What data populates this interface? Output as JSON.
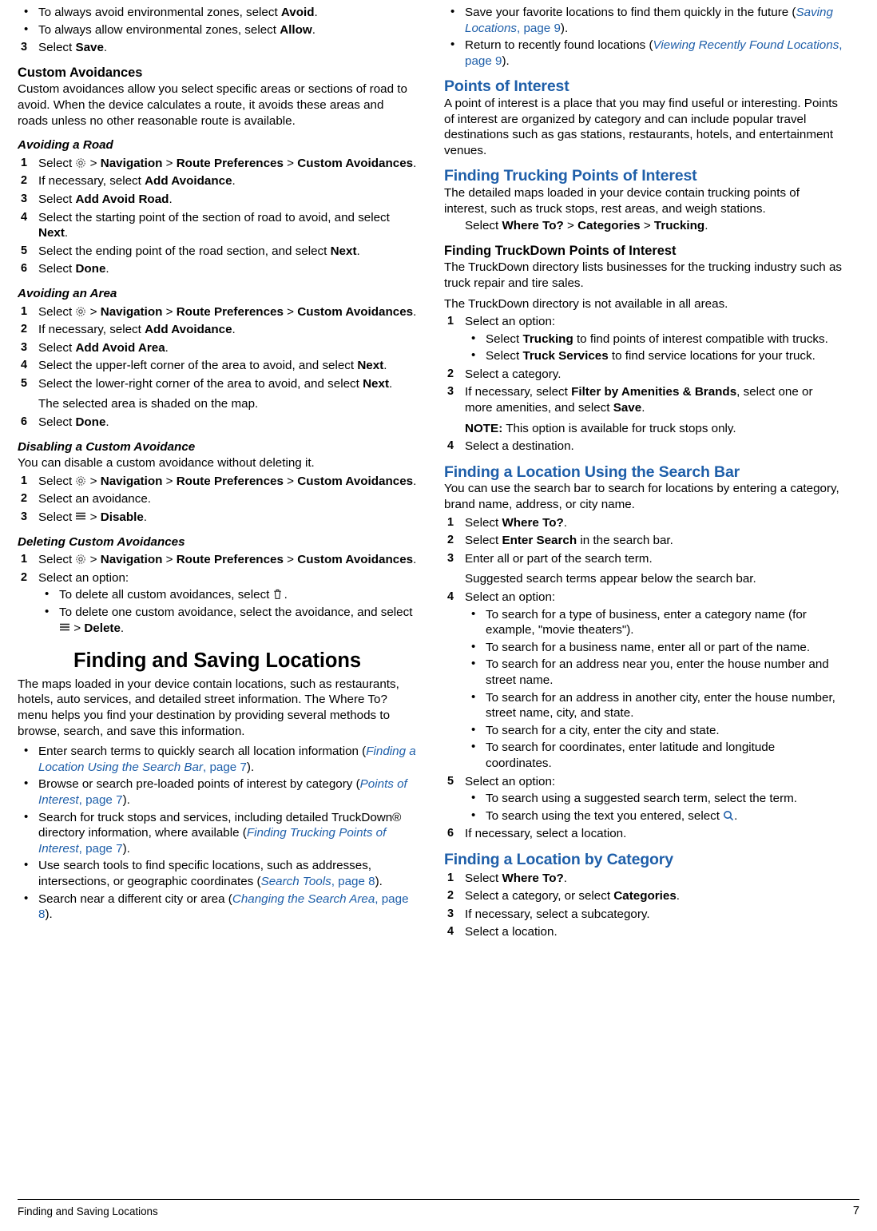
{
  "footer": {
    "left": "Finding and Saving Locations",
    "page": "7"
  },
  "left_column": {
    "top_bullets": [
      {
        "pre": "To always avoid environmental zones, select ",
        "b": "Avoid",
        "post": "."
      },
      {
        "pre": "To always allow environmental zones, select ",
        "b": "Allow",
        "post": "."
      }
    ],
    "step3": {
      "num": "3",
      "pre": "Select ",
      "b": "Save",
      "post": "."
    },
    "custom_avoidances": {
      "heading": "Custom Avoidances",
      "body": "Custom avoidances allow you select specific areas or sections of road to avoid. When the device calculates a route, it avoids these areas and roads unless no other reasonable route is available."
    },
    "avoiding_road": {
      "heading": "Avoiding a Road",
      "steps": [
        {
          "num": "1",
          "text_parts": [
            "Select ",
            "GEAR",
            " > ",
            "Navigation",
            " > ",
            "Route Preferences",
            " > ",
            "Custom Avoidances",
            "."
          ]
        },
        {
          "num": "2",
          "text_parts": [
            "If necessary, select ",
            "Add Avoidance",
            "."
          ]
        },
        {
          "num": "3",
          "text_parts": [
            "Select ",
            "Add Avoid Road",
            "."
          ]
        },
        {
          "num": "4",
          "text_parts": [
            "Select the starting point of the section of road to avoid, and select ",
            "Next",
            "."
          ]
        },
        {
          "num": "5",
          "text_parts": [
            "Select the ending point of the road section, and select ",
            "Next",
            "."
          ]
        },
        {
          "num": "6",
          "text_parts": [
            "Select ",
            "Done",
            "."
          ]
        }
      ]
    },
    "avoiding_area": {
      "heading": "Avoiding an Area",
      "steps": [
        {
          "num": "1",
          "text_parts": [
            "Select ",
            "GEAR",
            " > ",
            "Navigation",
            " > ",
            "Route Preferences",
            " > ",
            "Custom Avoidances",
            "."
          ]
        },
        {
          "num": "2",
          "text_parts": [
            "If necessary, select ",
            "Add Avoidance",
            "."
          ]
        },
        {
          "num": "3",
          "text_parts": [
            "Select ",
            "Add Avoid Area",
            "."
          ]
        },
        {
          "num": "4",
          "text_parts": [
            "Select the upper-left corner of the area to avoid, and select ",
            "Next",
            "."
          ]
        },
        {
          "num": "5",
          "text_parts": [
            "Select the lower-right corner of the area to avoid, and select ",
            "Next",
            "."
          ]
        },
        {
          "num": "6",
          "text_parts": [
            "Select ",
            "Done",
            "."
          ]
        }
      ],
      "note_after_5": "The selected area is shaded on the map."
    },
    "disabling": {
      "heading": "Disabling a Custom Avoidance",
      "body": "You can disable a custom avoidance without deleting it.",
      "steps": [
        {
          "num": "1",
          "text_parts": [
            "Select ",
            "GEAR",
            " > ",
            "Navigation",
            " > ",
            "Route Preferences",
            " > ",
            "Custom Avoidances",
            "."
          ]
        },
        {
          "num": "2",
          "text_parts": [
            "Select an avoidance."
          ]
        },
        {
          "num": "3",
          "text_parts": [
            "Select ",
            "MENU",
            " > ",
            "Disable",
            "."
          ]
        }
      ]
    },
    "deleting": {
      "heading": "Deleting Custom Avoidances",
      "steps": [
        {
          "num": "1",
          "text_parts": [
            "Select ",
            "GEAR",
            " > ",
            "Navigation",
            " > ",
            "Route Preferences",
            " > ",
            "Custom Avoidances",
            "."
          ]
        },
        {
          "num": "2",
          "text_parts": [
            "Select an option:"
          ]
        }
      ],
      "options": [
        {
          "pre": "To delete all custom avoidances, select ",
          "icon": "TRASH",
          "post": "."
        },
        {
          "pre": "To delete one custom avoidance, select the avoidance, and select ",
          "icon": "MENU",
          "mid": " > ",
          "b": "Delete",
          "post": "."
        }
      ]
    },
    "chapter_title": "Finding and Saving Locations",
    "chapter_intro": "The maps loaded in your device contain locations, such as restaurants, hotels, auto services, and detailed street information. The Where To? menu helps you find your destination by providing several methods to browse, search, and save this information.",
    "chapter_bullets": [
      {
        "text": "Enter search terms to quickly search all location information (",
        "xref": "Finding a Location Using the Search Bar",
        "xref_tail": ", page 7",
        "close": ")."
      },
      {
        "text": "Browse or search pre-loaded points of interest by category (",
        "xref": "Points of Interest",
        "xref_tail": ", page 7",
        "close": ")."
      },
      {
        "text": "Search for truck stops and services, including detailed TruckDown® directory information, where available (",
        "xref": "Finding Trucking Points of Interest",
        "xref_tail": ", page 7",
        "close": ")."
      },
      {
        "text": "Use search tools to find specific locations, such as addresses, intersections, or geographic coordinates (",
        "xref": "Search Tools",
        "xref_tail": ", page 8",
        "close": ")."
      },
      {
        "text": "Search near a different city or area (",
        "xref": "Changing the Search Area",
        "xref_tail": ", page 8",
        "close": ")."
      }
    ]
  },
  "right_column": {
    "top_bullets": [
      {
        "text": "Save your favorite locations to find them quickly in the future (",
        "xref": "Saving Locations",
        "xref_tail": ", page 9",
        "close": ")."
      },
      {
        "text": "Return to recently found locations (",
        "xref": "Viewing Recently Found Locations",
        "xref_tail": ", page 9",
        "close": ")."
      }
    ],
    "points_of_interest": {
      "heading": "Points of Interest",
      "body": "A point of interest is a place that you may find useful or interesting. Points of interest are organized by category and can include popular travel destinations such as gas stations, restaurants, hotels, and entertainment venues."
    },
    "finding_trucking_poi": {
      "heading": "Finding Trucking Points of Interest",
      "body": "The detailed maps loaded in your device contain trucking points of interest, such as truck stops, rest areas, and weigh stations.",
      "action_parts": [
        "Select ",
        "Where To?",
        " > ",
        "Categories",
        " > ",
        "Trucking",
        "."
      ]
    },
    "finding_truckdown": {
      "heading": "Finding TruckDown Points of Interest",
      "body1": "The TruckDown directory lists businesses for the trucking industry such as truck repair and tire sales.",
      "body2": "The TruckDown directory is not available in all areas.",
      "steps": [
        {
          "num": "1",
          "text": "Select an option:"
        },
        {
          "num": "2",
          "text": "Select a category."
        },
        {
          "num": "3",
          "parts": [
            "If necessary, select ",
            "Filter by Amenities & Brands",
            ", select one or more amenities, and select ",
            "Save",
            "."
          ]
        },
        {
          "num": "4",
          "text": "Select a destination."
        }
      ],
      "step1_options": [
        {
          "pre": "Select ",
          "b": "Trucking",
          "post": " to find points of interest compatible with trucks."
        },
        {
          "pre": "Select ",
          "b": "Truck Services",
          "post": " to find service locations for your truck."
        }
      ],
      "note": {
        "label": "NOTE:",
        "text": " This option is available for truck stops only."
      }
    },
    "search_bar": {
      "heading": "Finding a Location Using the Search Bar",
      "body": "You can use the search bar to search for locations by entering a category, brand name, address, or city name.",
      "steps": [
        {
          "num": "1",
          "parts": [
            "Select ",
            "Where To?",
            "."
          ]
        },
        {
          "num": "2",
          "parts": [
            "Select ",
            "Enter Search",
            " in the search bar."
          ]
        },
        {
          "num": "3",
          "parts": [
            "Enter all or part of the search term."
          ]
        },
        {
          "num": "4",
          "parts": [
            "Select an option:"
          ]
        },
        {
          "num": "5",
          "parts": [
            "Select an option:"
          ]
        },
        {
          "num": "6",
          "parts": [
            "If necessary, select a location."
          ]
        }
      ],
      "after_step3": "Suggested search terms appear below the search bar.",
      "step4_options": [
        "To search for a type of business, enter a category name (for example, \"movie theaters\").",
        "To search for a business name, enter all or part of the name.",
        "To search for an address near you, enter the house number and street name.",
        "To search for an address in another city, enter the house number, street name, city, and state.",
        "To search for a city, enter the city and state.",
        "To search for coordinates, enter latitude and longitude coordinates."
      ],
      "step5_options": [
        {
          "text": "To search using a suggested search term, select the term.",
          "icon": ""
        },
        {
          "text": "To search using the text you entered, select ",
          "icon": "SEARCH",
          "post": "."
        }
      ]
    },
    "by_category": {
      "heading": "Finding a Location by Category",
      "steps": [
        {
          "num": "1",
          "parts": [
            "Select ",
            "Where To?",
            "."
          ]
        },
        {
          "num": "2",
          "parts": [
            "Select a category, or select ",
            "Categories",
            "."
          ]
        },
        {
          "num": "3",
          "parts": [
            "If necessary, select a subcategory."
          ]
        },
        {
          "num": "4",
          "parts": [
            "Select a location."
          ]
        }
      ]
    }
  },
  "icons": {
    "gear": "gear-icon",
    "menu": "menu-icon",
    "trash": "trash-icon",
    "search": "search-icon"
  }
}
